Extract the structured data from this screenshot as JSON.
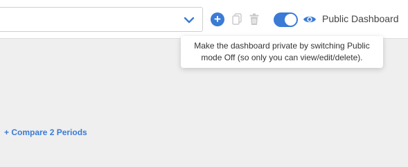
{
  "toolbar": {
    "select_value": "",
    "icons": {
      "chevron": "chevron-down-icon",
      "add": "plus-circle-icon",
      "copy": "copy-icon",
      "delete": "trash-icon",
      "eye": "eye-icon"
    },
    "add_glyph": "+",
    "public_toggle_on": true,
    "public_label": "Public Dashboard"
  },
  "tooltip": {
    "text": "Make the dashboard private by switching Public mode Off (so only you can view/edit/delete)."
  },
  "main": {
    "compare_link": "+ Compare 2 Periods"
  },
  "colors": {
    "accent": "#3a7bd5",
    "background": "#efefef",
    "disabled_icon": "#c8c8c8"
  }
}
